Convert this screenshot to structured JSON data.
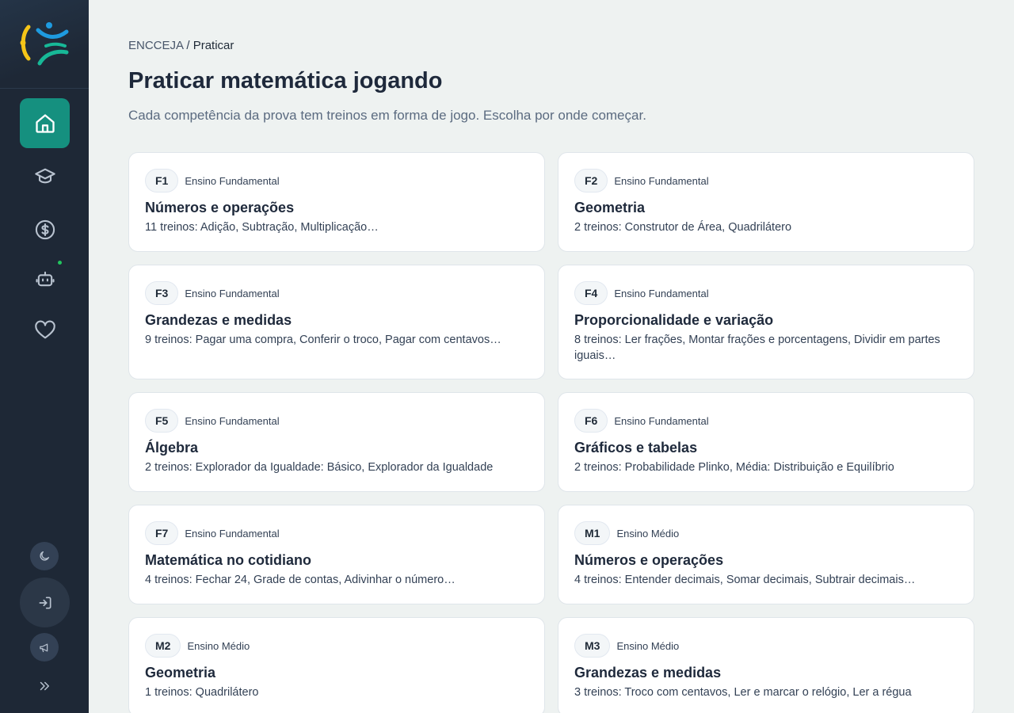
{
  "sidebar": {
    "logo_icon": "app-logo-icon",
    "nav": [
      {
        "icon": "home-icon",
        "active": true
      },
      {
        "icon": "graduation-cap-icon",
        "active": false
      },
      {
        "icon": "dollar-coin-icon",
        "active": false
      },
      {
        "icon": "robot-icon",
        "active": false
      },
      {
        "icon": "heart-icon",
        "active": false
      }
    ],
    "bottom": [
      "moon-icon",
      "logout-icon",
      "megaphone-icon",
      "chevrons-right-icon"
    ]
  },
  "breadcrumb": {
    "root": "ENCCEJA",
    "separator": "/",
    "current": "Praticar"
  },
  "page": {
    "title": "Praticar matemática jogando",
    "subtitle": "Cada competência da prova tem treinos em forma de jogo. Escolha por onde começar."
  },
  "cards": [
    {
      "code": "F1",
      "level": "Ensino Fundamental",
      "title": "Números e operações",
      "desc": "11 treinos: Adição, Subtração, Multiplicação…"
    },
    {
      "code": "F2",
      "level": "Ensino Fundamental",
      "title": "Geometria",
      "desc": "2 treinos: Construtor de Área, Quadrilátero"
    },
    {
      "code": "F3",
      "level": "Ensino Fundamental",
      "title": "Grandezas e medidas",
      "desc": "9 treinos: Pagar uma compra, Conferir o troco, Pagar com centavos…"
    },
    {
      "code": "F4",
      "level": "Ensino Fundamental",
      "title": "Proporcionalidade e variação",
      "desc": "8 treinos: Ler frações, Montar frações e porcentagens, Dividir em partes iguais…"
    },
    {
      "code": "F5",
      "level": "Ensino Fundamental",
      "title": "Álgebra",
      "desc": "2 treinos: Explorador da Igualdade: Básico, Explorador da Igualdade"
    },
    {
      "code": "F6",
      "level": "Ensino Fundamental",
      "title": "Gráficos e tabelas",
      "desc": "2 treinos: Probabilidade Plinko, Média: Distribuição e Equilíbrio"
    },
    {
      "code": "F7",
      "level": "Ensino Fundamental",
      "title": "Matemática no cotidiano",
      "desc": "4 treinos: Fechar 24, Grade de contas, Adivinhar o número…"
    },
    {
      "code": "M1",
      "level": "Ensino Médio",
      "title": "Números e operações",
      "desc": "4 treinos: Entender decimais, Somar decimais, Subtrair decimais…"
    },
    {
      "code": "M2",
      "level": "Ensino Médio",
      "title": "Geometria",
      "desc": "1 treinos: Quadrilátero"
    },
    {
      "code": "M3",
      "level": "Ensino Médio",
      "title": "Grandezas e medidas",
      "desc": "3 treinos: Troco com centavos, Ler e marcar o relógio, Ler a régua"
    }
  ],
  "colors": {
    "accent": "#15907f",
    "sidebar": "#1e2836",
    "background": "#eef2f1",
    "logo_yellow": "#f5c518",
    "logo_blue": "#1e9be0",
    "logo_green": "#17b897"
  }
}
